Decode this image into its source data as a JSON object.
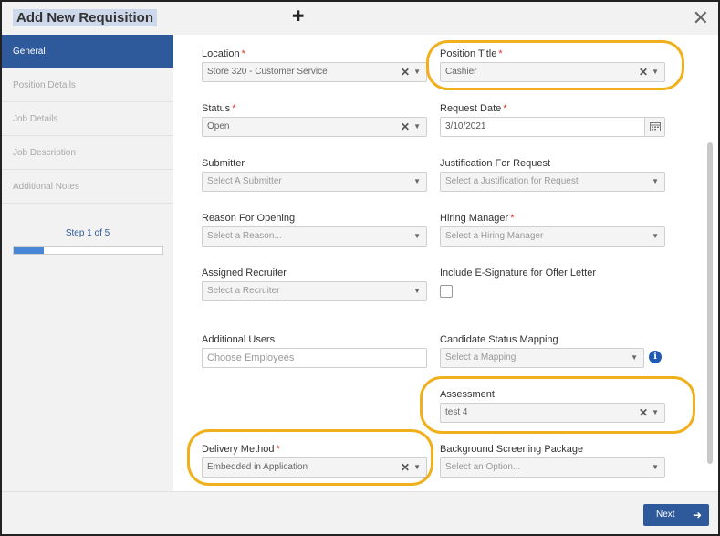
{
  "dialog": {
    "title": "Add New Requisition",
    "close_icon": "close-icon",
    "move_icon": "move-cursor-icon"
  },
  "sidebar": {
    "items": [
      {
        "label": "General",
        "active": true
      },
      {
        "label": "Position Details",
        "active": false
      },
      {
        "label": "Job Details",
        "active": false
      },
      {
        "label": "Job Description",
        "active": false
      },
      {
        "label": "Additional Notes",
        "active": false
      }
    ],
    "step_label": "Step 1 of 5",
    "progress": 0.2
  },
  "form": {
    "location": {
      "label": "Location",
      "required": "*",
      "value": "Store 320 - Customer Service"
    },
    "position_title": {
      "label": "Position Title",
      "required": "*",
      "value": "Cashier"
    },
    "status": {
      "label": "Status",
      "required": "*",
      "value": "Open"
    },
    "request_date": {
      "label": "Request Date",
      "required": "*",
      "value": "3/10/2021"
    },
    "submitter": {
      "label": "Submitter",
      "placeholder": "Select A Submitter"
    },
    "justification": {
      "label": "Justification For Request",
      "placeholder": "Select a Justification for Request"
    },
    "reason": {
      "label": "Reason For Opening",
      "placeholder": "Select a Reason..."
    },
    "hiring_manager": {
      "label": "Hiring Manager",
      "required": "*",
      "placeholder": "Select a Hiring Manager"
    },
    "recruiter": {
      "label": "Assigned Recruiter",
      "placeholder": "Select a Recruiter"
    },
    "esignature": {
      "label": "Include E-Signature for Offer Letter",
      "checked": false
    },
    "additional_users": {
      "label": "Additional Users",
      "placeholder": "Choose Employees"
    },
    "candidate_status": {
      "label": "Candidate Status Mapping",
      "placeholder": "Select a Mapping",
      "info_icon": "info-icon"
    },
    "assessment": {
      "label": "Assessment",
      "value": "test 4"
    },
    "delivery_method": {
      "label": "Delivery Method",
      "required": "*",
      "value": "Embedded in Application"
    },
    "background": {
      "label": "Background Screening Package",
      "placeholder": "Select an Option..."
    }
  },
  "footer": {
    "next_label": "Next"
  },
  "colors": {
    "primary": "#2e5a9c",
    "highlight": "#f0b01d",
    "required": "#d9362b",
    "info": "#1f5ab5"
  }
}
